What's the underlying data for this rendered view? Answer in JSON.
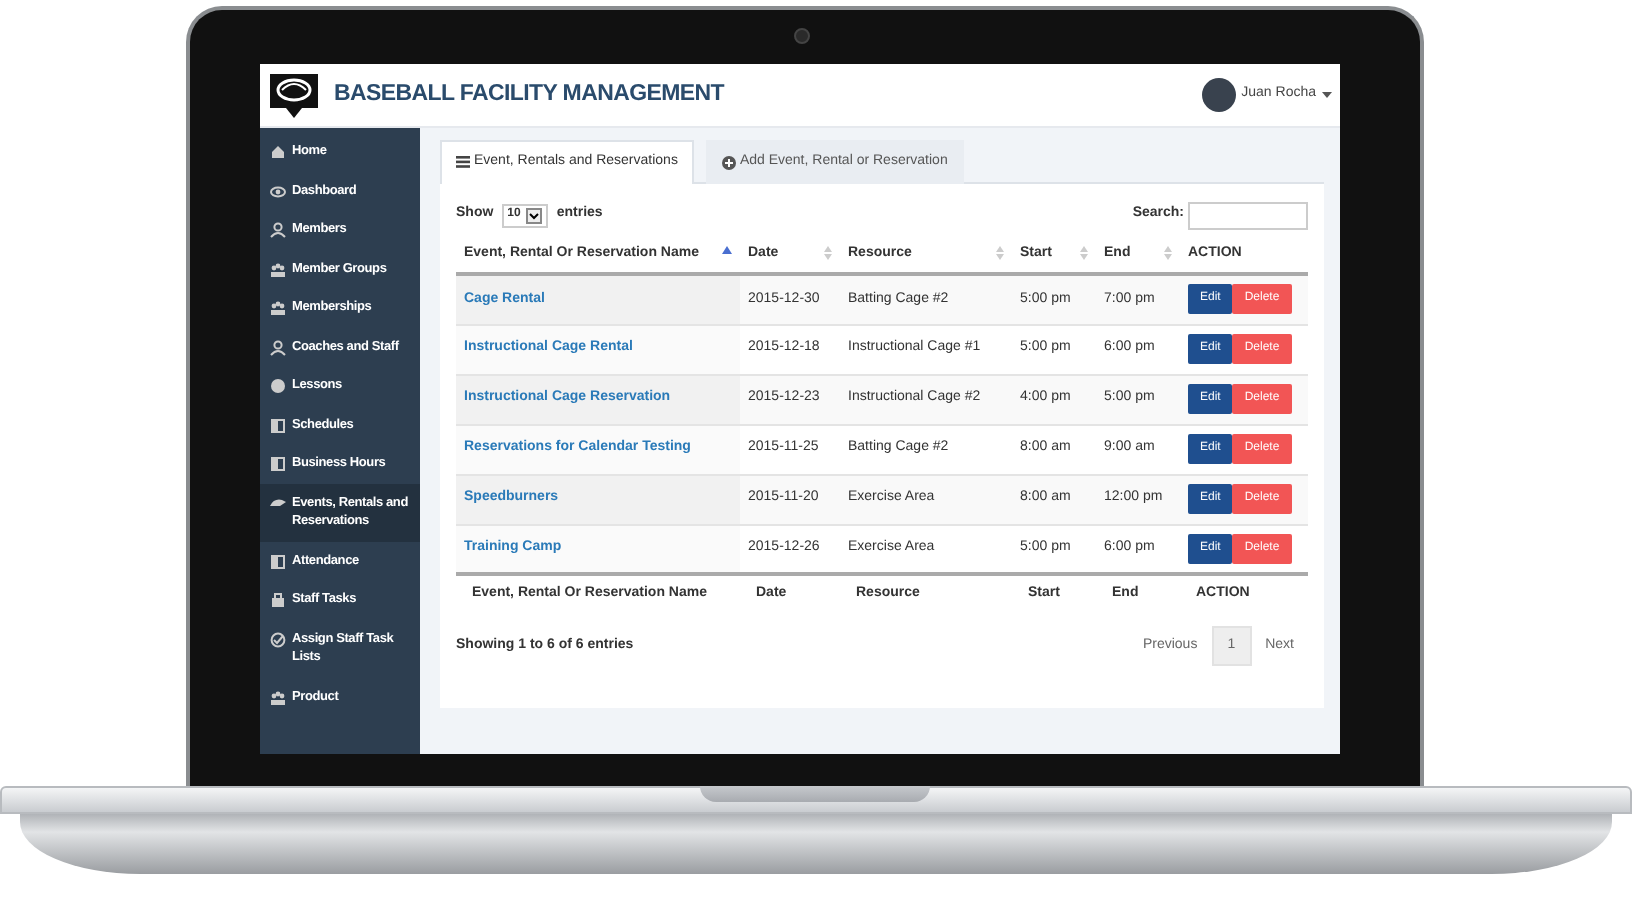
{
  "app": {
    "title": "BASEBALL FACILITY MANAGEMENT",
    "user": "Juan Rocha"
  },
  "sidebar": {
    "items": [
      {
        "label": "Home",
        "selected": false
      },
      {
        "label": "Dashboard",
        "selected": false
      },
      {
        "label": "Members",
        "selected": false
      },
      {
        "label": "Member Groups",
        "selected": false
      },
      {
        "label": "Memberships",
        "selected": false
      },
      {
        "label": "Coaches and Staff",
        "selected": false
      },
      {
        "label": "Lessons",
        "selected": false
      },
      {
        "label": "Schedules",
        "selected": false
      },
      {
        "label": "Business Hours",
        "selected": false
      },
      {
        "label": "Events, Rentals and Reservations",
        "selected": true
      },
      {
        "label": "Attendance",
        "selected": false
      },
      {
        "label": "Staff Tasks",
        "selected": false
      },
      {
        "label": "Assign Staff Task Lists",
        "selected": false
      },
      {
        "label": "Product",
        "selected": false
      }
    ]
  },
  "tabs": [
    {
      "label": "Event, Rentals and Reservations",
      "selected": true
    },
    {
      "label": "Add Event, Rental or Reservation",
      "selected": false
    }
  ],
  "controls": {
    "show_label": "Show",
    "page_size": "10",
    "entries_label": "entries",
    "search_label": "Search:"
  },
  "table": {
    "columns": [
      {
        "label": "Event, Rental Or Reservation Name",
        "sortable": true,
        "sorted": true
      },
      {
        "label": "Date",
        "sortable": true,
        "sorted": false
      },
      {
        "label": "Resource",
        "sortable": true,
        "sorted": false
      },
      {
        "label": "Start",
        "sortable": true,
        "sorted": false
      },
      {
        "label": "End",
        "sortable": true,
        "sorted": false
      },
      {
        "label": "ACTION",
        "sortable": false,
        "sorted": false
      }
    ],
    "rows": [
      {
        "name": "Cage Rental",
        "date": "2015-12-30",
        "resource": "Batting Cage #2",
        "start": "5:00 pm",
        "end": "7:00 pm",
        "edit": "Edit",
        "delete": "Delete"
      },
      {
        "name": "Instructional Cage Rental",
        "date": "2015-12-18",
        "resource": "Instructional Cage #1",
        "start": "5:00 pm",
        "end": "6:00 pm",
        "edit": "Edit",
        "delete": "Delete"
      },
      {
        "name": "Instructional Cage Reservation",
        "date": "2015-12-23",
        "resource": "Instructional Cage #2",
        "start": "4:00 pm",
        "end": "5:00 pm",
        "edit": "Edit",
        "delete": "Delete"
      },
      {
        "name": "Reservations for Calendar Testing",
        "date": "2015-11-25",
        "resource": "Batting Cage #2",
        "start": "8:00 am",
        "end": "9:00 am",
        "edit": "Edit",
        "delete": "Delete"
      },
      {
        "name": "Speedburners",
        "date": "2015-11-20",
        "resource": "Exercise Area",
        "start": "8:00 am",
        "end": "12:00 pm",
        "edit": "Edit",
        "delete": "Delete"
      },
      {
        "name": "Training Camp",
        "date": "2015-12-26",
        "resource": "Exercise Area",
        "start": "5:00 pm",
        "end": "6:00 pm",
        "edit": "Edit",
        "delete": "Delete"
      }
    ],
    "footer": [
      "Event, Rental Or Reservation Name",
      "Date",
      "Resource",
      "Start",
      "End",
      "ACTION"
    ]
  },
  "info": "Showing 1 to 6 of 6 entries",
  "pagination": [
    {
      "label": "Previous",
      "selected": false
    },
    {
      "label": "1",
      "selected": true
    },
    {
      "label": "Next",
      "selected": false
    }
  ]
}
